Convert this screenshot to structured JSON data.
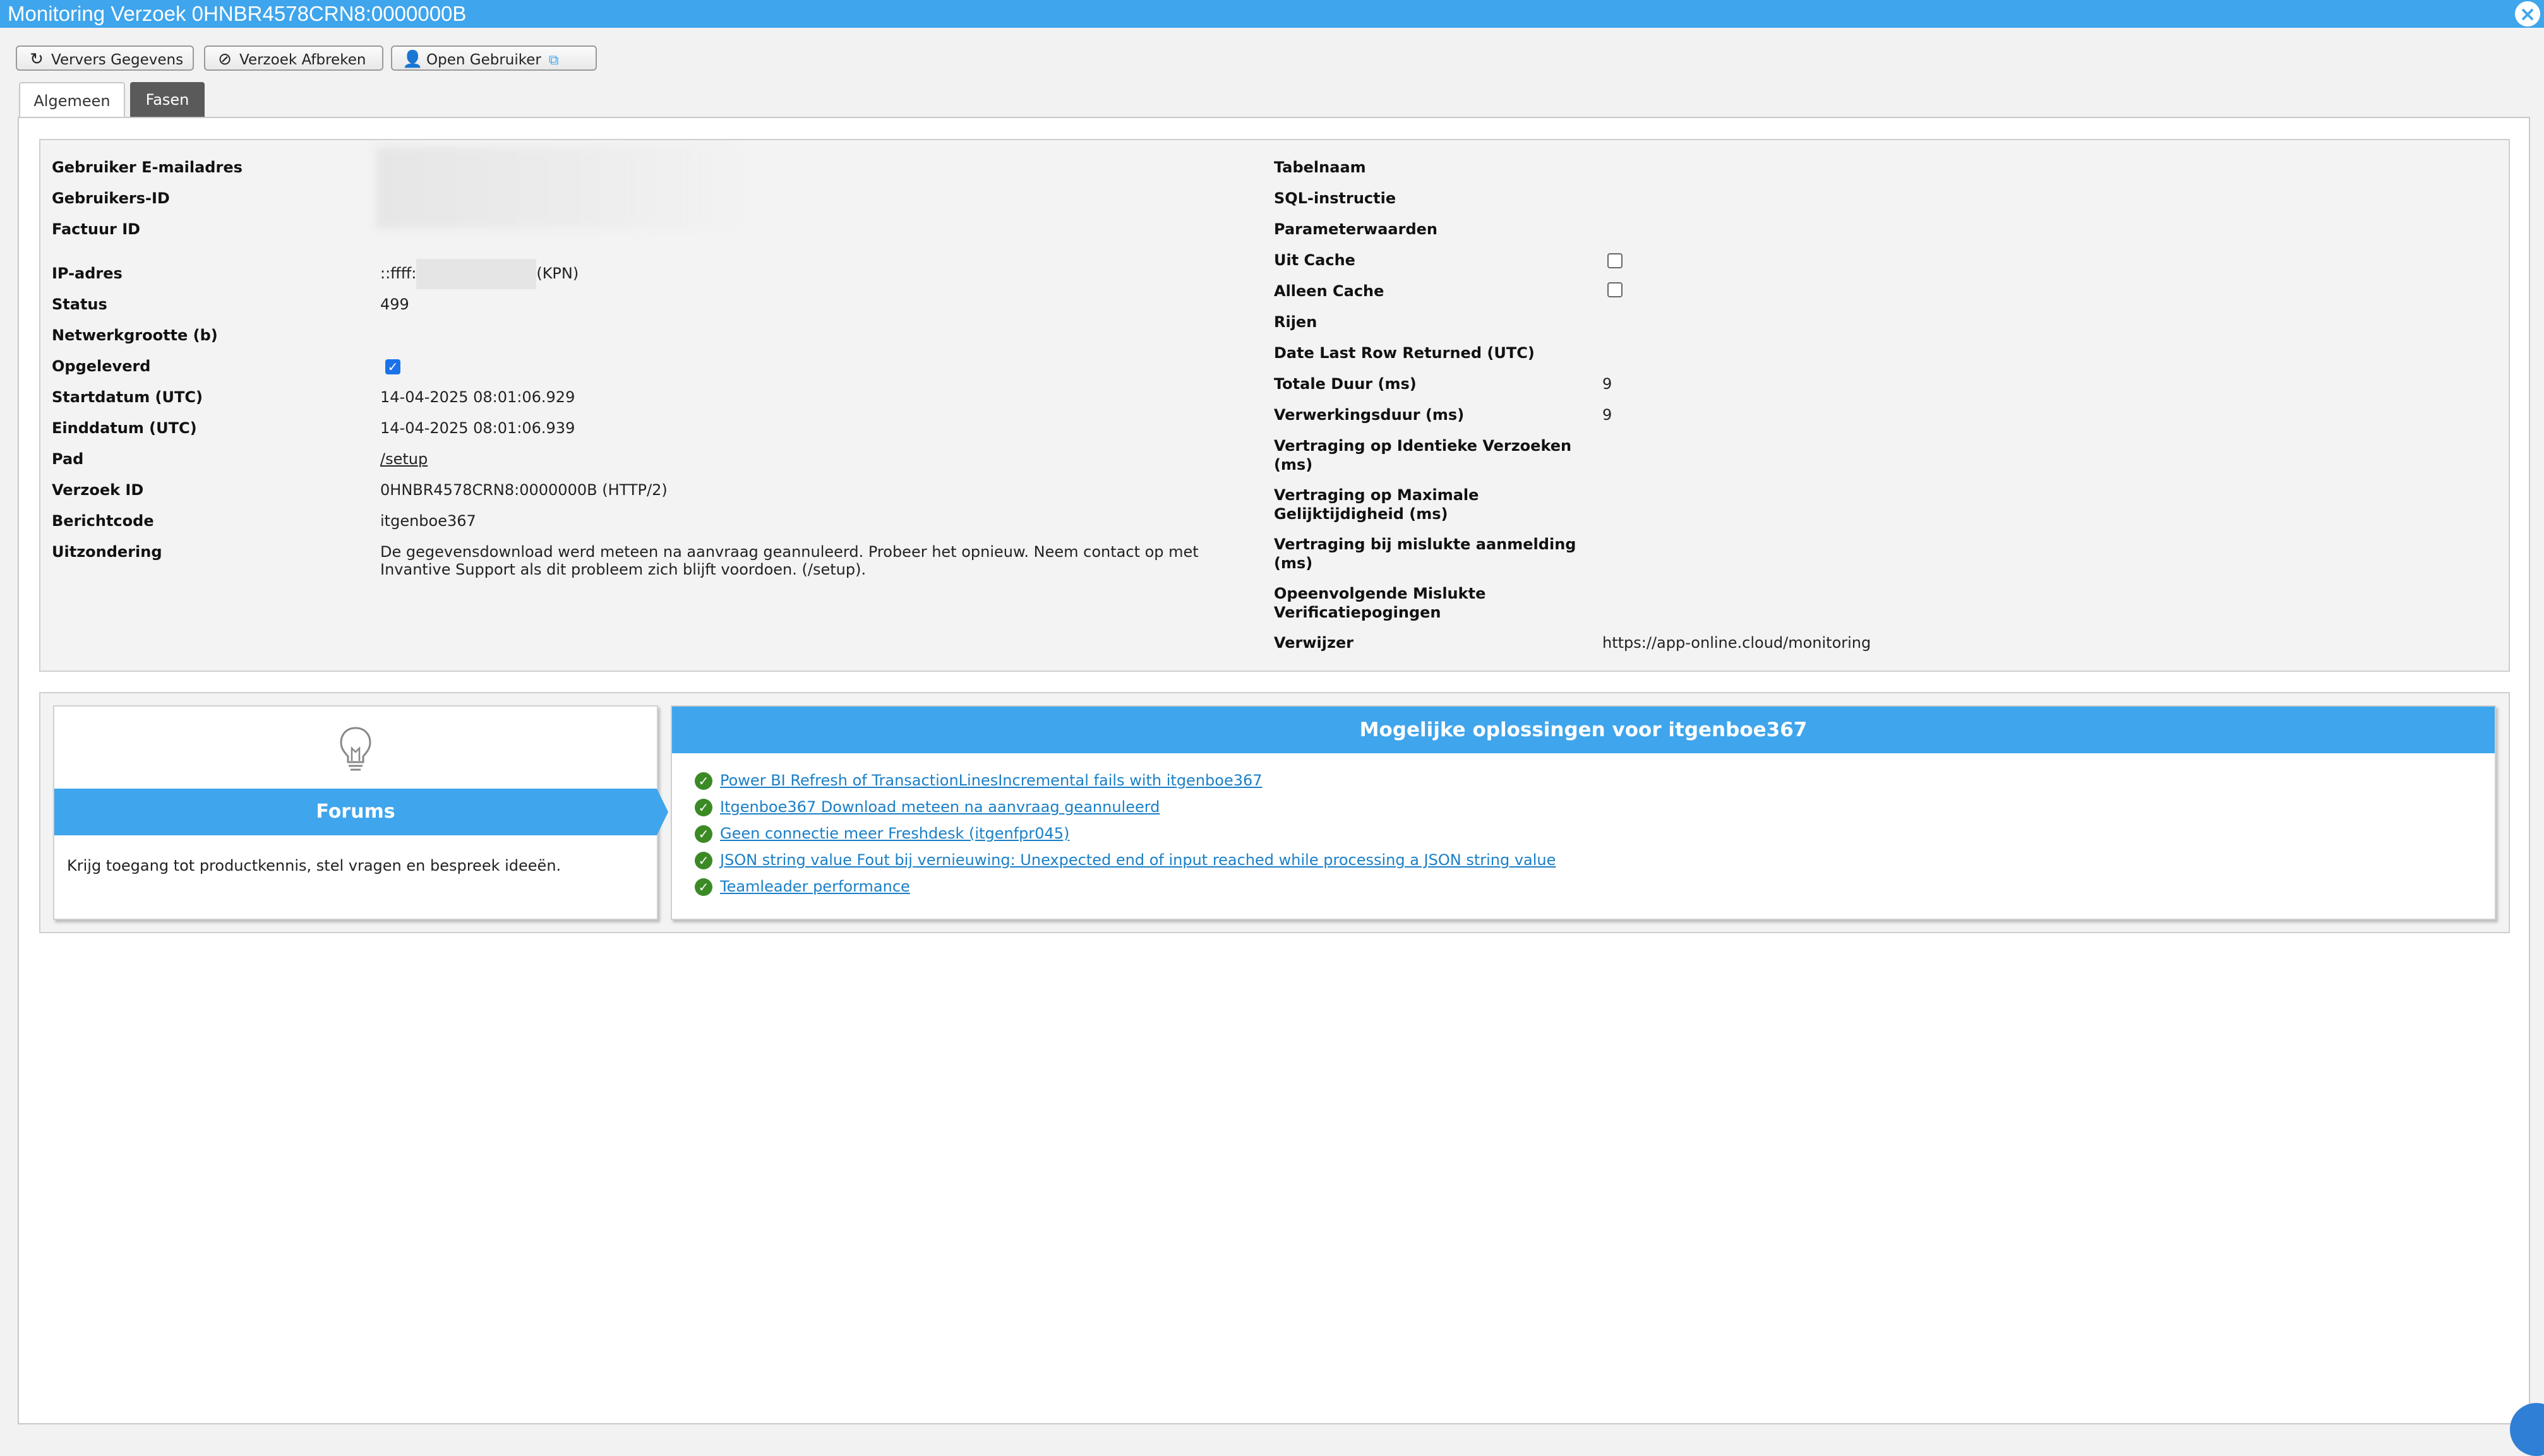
{
  "window": {
    "title": "Monitoring Verzoek 0HNBR4578CRN8:0000000B"
  },
  "toolbar": {
    "refresh_label": "Ververs Gegevens",
    "abort_label": "Verzoek Afbreken",
    "open_user_label": "Open Gebruiker"
  },
  "tabs": [
    {
      "label": "Algemeen",
      "active": true
    },
    {
      "label": "Fasen",
      "active": false
    }
  ],
  "left_fields": {
    "email_label": "Gebruiker E-mailadres",
    "userid_label": "Gebruikers-ID",
    "invoice_label": "Factuur ID",
    "ip_label": "IP-adres",
    "ip_prefix": "::ffff:",
    "ip_suffix": "(KPN)",
    "status_label": "Status",
    "status_value": "499",
    "netsize_label": "Netwerkgrootte (b)",
    "delivered_label": "Opgeleverd",
    "delivered_checked": true,
    "start_label": "Startdatum (UTC)",
    "start_value": "14-04-2025 08:01:06.929",
    "end_label": "Einddatum (UTC)",
    "end_value": "14-04-2025 08:01:06.939",
    "path_label": "Pad",
    "path_value": "/setup",
    "requestid_label": "Verzoek ID",
    "requestid_value": "0HNBR4578CRN8:0000000B (HTTP/2)",
    "msgcode_label": "Berichtcode",
    "msgcode_value": "itgenboe367",
    "exception_label": "Uitzondering",
    "exception_line1": "De gegevensdownload werd meteen na aanvraag geannuleerd. Probeer het opnieuw. Neem contact op met",
    "exception_line2": "Invantive Support als dit probleem zich blijft voordoen. (/setup)."
  },
  "right_fields": {
    "table_label": "Tabelnaam",
    "sql_label": "SQL-instructie",
    "params_label": "Parameterwaarden",
    "fromcache_label": "Uit Cache",
    "fromcache_checked": false,
    "onlycache_label": "Alleen Cache",
    "onlycache_checked": false,
    "rows_label": "Rijen",
    "lastrow_label": "Date Last Row Returned (UTC)",
    "totalduration_label": "Totale Duur (ms)",
    "totalduration_value": "9",
    "processing_label": "Verwerkingsduur (ms)",
    "processing_value": "9",
    "delay_identical_l1": "Vertraging op Identieke Verzoeken",
    "delay_identical_l2": "(ms)",
    "delay_max_l1": "Vertraging op Maximale",
    "delay_max_l2": "Gelijktijdigheid (ms)",
    "delay_failed_l1": "Vertraging bij mislukte aanmelding",
    "delay_failed_l2": "(ms)",
    "consecutive_l1": "Opeenvolgende Mislukte",
    "consecutive_l2": "Verificatiepogingen",
    "referrer_label": "Verwijzer",
    "referrer_value": "https://app-online.cloud/monitoring"
  },
  "forums": {
    "title": "Forums",
    "description": "Krijg toegang tot productkennis, stel vragen en bespreek ideeën."
  },
  "solutions": {
    "title": "Mogelijke oplossingen voor itgenboe367",
    "items": [
      "Power BI Refresh of TransactionLinesIncremental fails with itgenboe367",
      "Itgenboe367 Download meteen na aanvraag geannuleerd",
      "Geen connectie meer Freshdesk (itgenfpr045)",
      "JSON string value Fout bij vernieuwing: Unexpected end of input reached while processing a JSON string value",
      "Teamleader performance"
    ]
  },
  "colors": {
    "accent": "#3fa5ec",
    "check_ok": "#3c8a26",
    "link": "#1a7fc7"
  },
  "icons": [
    "refresh-icon",
    "ban-icon",
    "user-icon",
    "external-link-icon",
    "close-icon",
    "lightbulb-icon",
    "check-circle-icon"
  ]
}
